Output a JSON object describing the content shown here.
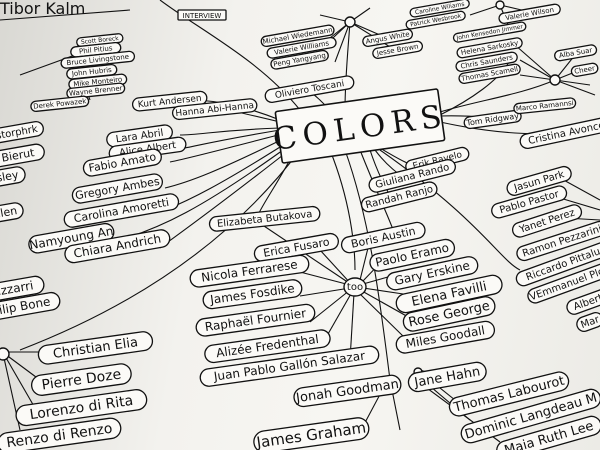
{
  "header": {
    "tibor": "Tibor Kalm",
    "interview": "INTERVIEW"
  },
  "center_title": "COLORS",
  "hubs": [
    {
      "id": "too",
      "label": "too"
    }
  ],
  "names": {
    "top_center": [
      "Oliviero Toscani",
      "Tom Ridgway",
      "Marco Ramannsi"
    ],
    "left_mid": [
      "Kurt Andersen",
      "Hanna Abi-Hanna",
      "Lara Abril",
      "Alice Albert",
      "Fabio Amato",
      "Gregory Ambes",
      "Carolina Amoretti",
      "Namyoung An",
      "Chiara Andrich"
    ],
    "left_upper": [
      "Scott Boreck",
      "Phil Pitius",
      "Bruce Livingstone",
      "John Hubris",
      "Mike Monteiro",
      "Wayne Brenner",
      "Derek Powazek"
    ],
    "left_edge": [
      "Astorphrk",
      "el Bierut",
      "sley",
      "elen",
      "Bizzarri",
      "Philip Bone"
    ],
    "center_right": [
      "Erik Ravelo",
      "Giuliana Rando",
      "Randah Ranjo"
    ],
    "mid_list": [
      "Elizabeta Butakova",
      "Erica Fusaro",
      "Nicola Ferrarese",
      "James Fosdike",
      "Raphaël Fournier",
      "Alizée Fredenthal",
      "Juan Pablo Gallón Salazar"
    ],
    "too_right": [
      "Boris Austin",
      "Paolo Eramo",
      "Gary Erskine",
      "Elena Favilli",
      "Rose George",
      "Miles Goodall"
    ],
    "bottom_left": [
      "Christian Elia",
      "Pierre Doze",
      "Lorenzo di Rita",
      "Renzo di Renzo"
    ],
    "bottom_mid": [
      "Jonah Goodman",
      "James Graham"
    ],
    "bottom_right": [
      "Jane Hahn",
      "Thomas Labourot",
      "Dominic Langdeau M",
      "Maia Ruth Lee"
    ],
    "right_edge": [
      "Cristina Avonce",
      "Jasun Park",
      "Pablo Pastor",
      "Yanet Perez",
      "Ramon Pezzarini",
      "Riccardo Pittaluga",
      "VEmmanuel Plou",
      "Albert",
      "Mar"
    ],
    "top_right": [
      "Helena Sarkosky",
      "Alba Suar",
      "Chris Saunders",
      "Thomas Scamell",
      "Cheer",
      "Caroline Wiliams",
      "Patrick Wesbrook",
      "Valerie Wilson",
      "John Kensedon Jimmer"
    ],
    "top_mid": [
      "Michael Wiedemann",
      "Valerie Williams",
      "Peng Yangyang",
      "Angus White",
      "Jesse Brown"
    ]
  }
}
